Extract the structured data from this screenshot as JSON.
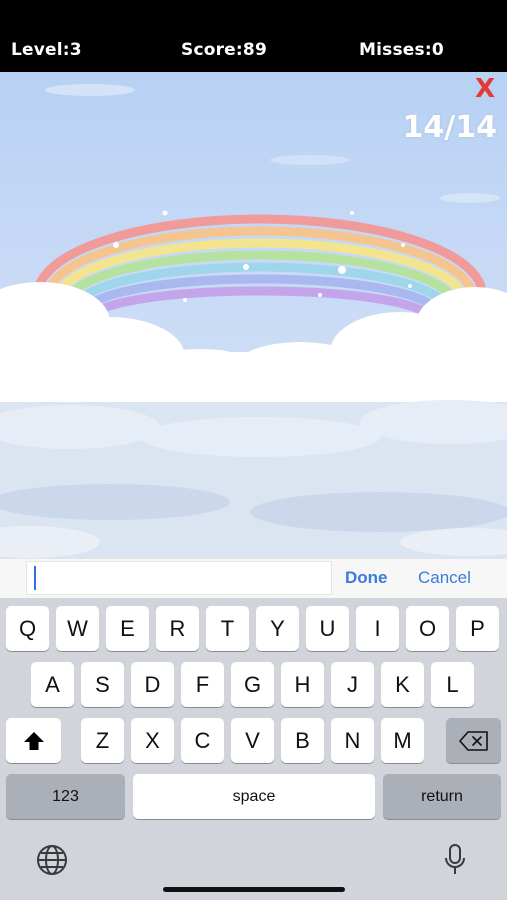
{
  "hud": {
    "level": "Level:3",
    "score": "Score:89",
    "misses": "Misses:0"
  },
  "game": {
    "close_label": "X",
    "progress": "14/14"
  },
  "input_bar": {
    "value": "",
    "done_label": "Done",
    "cancel_label": "Cancel"
  },
  "keyboard": {
    "row1": [
      "Q",
      "W",
      "E",
      "R",
      "T",
      "Y",
      "U",
      "I",
      "O",
      "P"
    ],
    "row2": [
      "A",
      "S",
      "D",
      "F",
      "G",
      "H",
      "J",
      "K",
      "L"
    ],
    "row3": [
      "Z",
      "X",
      "C",
      "V",
      "B",
      "N",
      "M"
    ],
    "numbers_label": "123",
    "space_label": "space",
    "return_label": "return",
    "icons": [
      "shift-icon",
      "backspace-icon",
      "globe-icon",
      "microphone-icon"
    ]
  },
  "colors": {
    "hud_bg": "#000000",
    "close_red": "#e53935",
    "accent_blue": "#3a7bdc"
  }
}
